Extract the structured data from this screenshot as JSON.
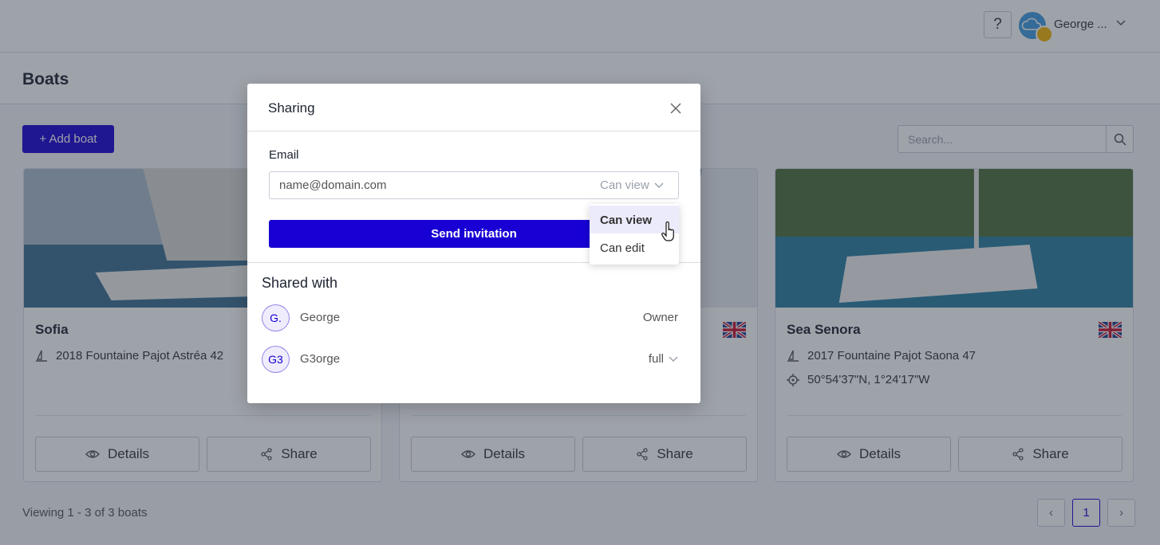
{
  "topbar": {
    "help_label": "?",
    "user_name": "George ...",
    "avatar_color": "#3f9be0",
    "badge_color": "#f2b705"
  },
  "page": {
    "title": "Boats",
    "add_button_label": "+ Add boat",
    "search_placeholder": "Search...",
    "viewing_text": "Viewing 1 - 3 of 3 boats",
    "pagination": {
      "prev": "‹",
      "current": "1",
      "next": "›"
    }
  },
  "boats": [
    {
      "name": "Sofia",
      "model": "2018 Fountaine Pajot Astréa 42",
      "location": "",
      "details_label": "Details",
      "share_label": "Share"
    },
    {
      "name": "",
      "model": "",
      "location": "",
      "details_label": "Details",
      "share_label": "Share"
    },
    {
      "name": "Sea Senora",
      "model": "2017 Fountaine Pajot Saona 47",
      "location": "50°54'37\"N, 1°24'17\"W",
      "details_label": "Details",
      "share_label": "Share"
    }
  ],
  "modal": {
    "title": "Sharing",
    "email_label": "Email",
    "email_placeholder": "name@domain.com",
    "permission_selected": "Can view",
    "send_button_label": "Send invitation",
    "shared_with_title": "Shared with",
    "shared_with": [
      {
        "initials": "G.",
        "name": "George",
        "role": "Owner"
      },
      {
        "initials": "G3",
        "name": "G3orge",
        "role": "full"
      }
    ]
  },
  "permission_dropdown": {
    "options": [
      "Can view",
      "Can edit"
    ],
    "selected_index": 0
  },
  "colors": {
    "primary": "#1800d4",
    "overlay": "rgba(40,48,64,0.45)"
  }
}
